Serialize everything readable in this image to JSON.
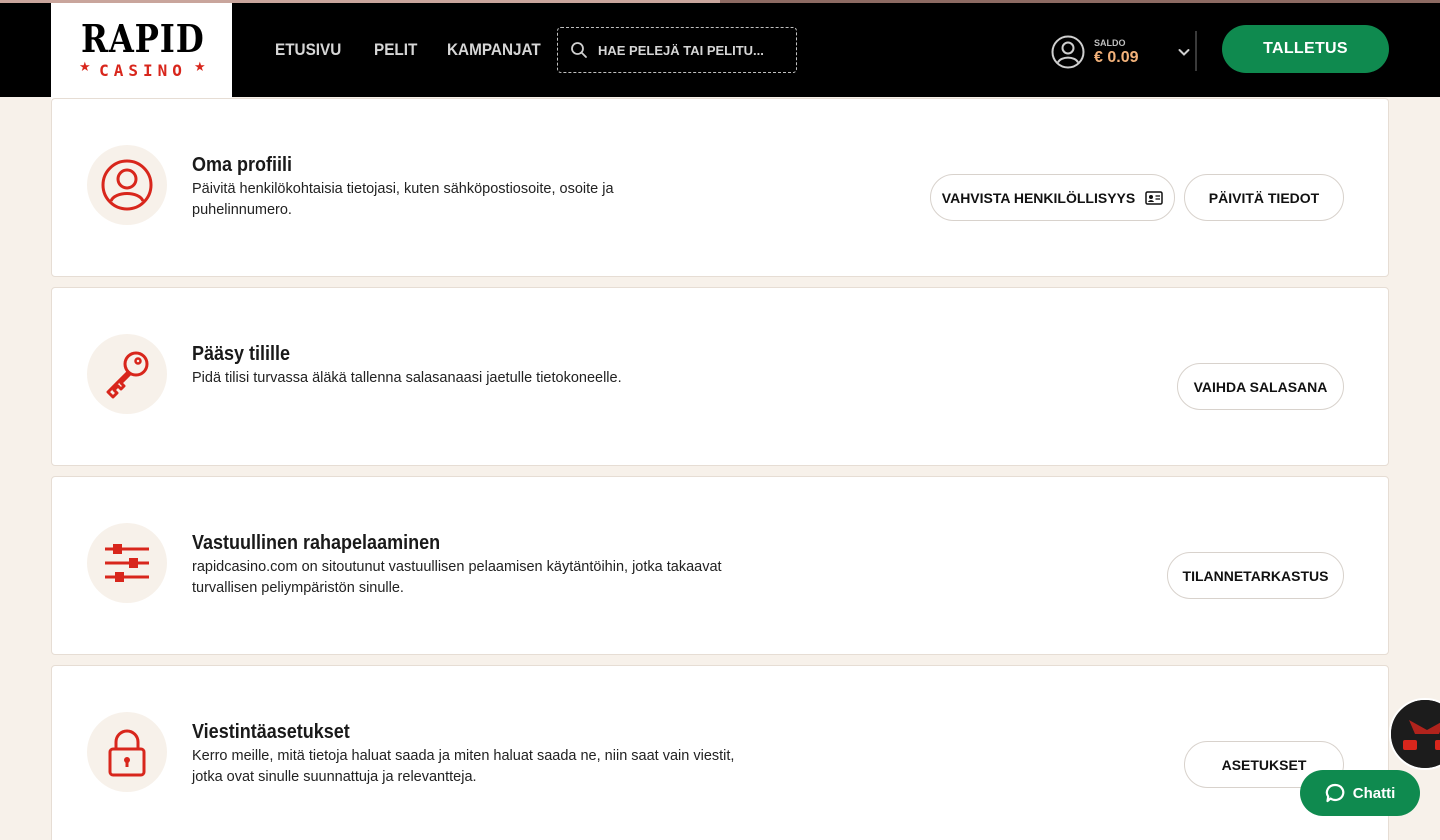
{
  "header": {
    "logo_word": "RAPID",
    "logo_sub": "CASINO",
    "nav": [
      "ETUSIVU",
      "PELIT",
      "KAMPANJAT"
    ],
    "search_placeholder": "HAE PELEJÄ TAI PELITU...",
    "balance_label": "SALDO",
    "balance_amount": "€ 0.09",
    "deposit_label": "TALLETUS"
  },
  "sections": [
    {
      "title": "Oma profiili",
      "description": "Päivitä henkilökohtaisia tietojasi, kuten sähköpostiosoite, osoite ja puhelinnumero.",
      "icon": "user-icon",
      "buttons": [
        "VAHVISTA HENKILÖLLISYYS",
        "PÄIVITÄ TIEDOT"
      ]
    },
    {
      "title": "Pääsy tilille",
      "description": "Pidä tilisi turvassa äläkä tallenna salasanaasi jaetulle tietokoneelle.",
      "icon": "key-icon",
      "buttons": [
        "VAIHDA SALASANA"
      ]
    },
    {
      "title": "Vastuullinen rahapelaaminen",
      "description": "rapidcasino.com on sitoutunut vastuullisen pelaamisen käytäntöihin, jotka takaavat turvallisen peliympäristön sinulle.",
      "icon": "sliders-icon",
      "buttons": [
        "TILANNETARKASTUS"
      ]
    },
    {
      "title": "Viestintäasetukset",
      "description": "Kerro meille, mitä tietoja haluat saada ja miten haluat saada ne, niin saat vain viestit, jotka ovat sinulle suunnattuja ja relevantteja.",
      "icon": "lock-icon",
      "buttons": [
        "ASETUKSET"
      ]
    }
  ],
  "chat": {
    "label": "Chatti"
  },
  "colors": {
    "accent": "#d8261c",
    "green": "#0f8a4f",
    "balance": "#f3b27a"
  }
}
